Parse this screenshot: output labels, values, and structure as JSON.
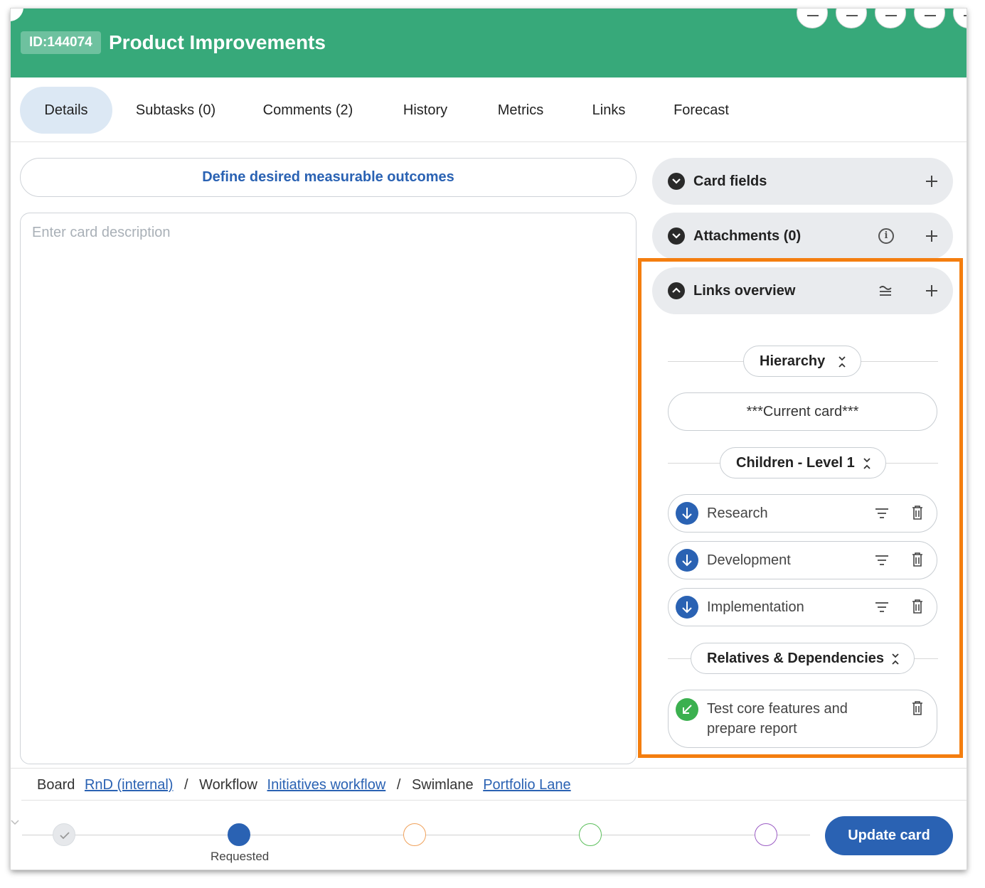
{
  "header": {
    "id_badge": "ID:144074",
    "title": "Product Improvements",
    "background_color": "#37a97a"
  },
  "tabs": [
    {
      "label": "Details",
      "active": true
    },
    {
      "label": "Subtasks (0)"
    },
    {
      "label": "Comments (2)"
    },
    {
      "label": "History"
    },
    {
      "label": "Metrics"
    },
    {
      "label": "Links"
    },
    {
      "label": "Forecast"
    }
  ],
  "main": {
    "outcomes_button": "Define desired measurable outcomes",
    "description_placeholder": "Enter card description"
  },
  "panels": {
    "card_fields": {
      "title": "Card fields",
      "icon": "chevron-down-icon"
    },
    "attachments": {
      "title": "Attachments (0)",
      "icon": "chevron-down-icon"
    },
    "links_overview": {
      "title": "Links overview",
      "icon": "chevron-up-icon"
    }
  },
  "links_overview": {
    "hierarchy_label": "Hierarchy",
    "current_card": "***Current card***",
    "children_label": "Children - Level 1",
    "children": [
      {
        "label": "Research",
        "icon": "arrow-down-icon"
      },
      {
        "label": "Development",
        "icon": "arrow-down-icon"
      },
      {
        "label": "Implementation",
        "icon": "arrow-down-icon"
      }
    ],
    "relatives_label": "Relatives & Dependencies",
    "relatives": [
      {
        "line1": "Test core features and",
        "line2": "prepare report",
        "icon": "arrow-down-left-icon"
      }
    ],
    "highlight_color": "#f47e0f"
  },
  "breadcrumb": {
    "board_label": "Board",
    "board_value": "RnD (internal)",
    "workflow_label": "Workflow",
    "workflow_value": "Initiatives workflow",
    "swimlane_label": "Swimlane",
    "swimlane_value": "Portfolio Lane",
    "separator": "/"
  },
  "workflow_steps": [
    {
      "state": "done",
      "color": "#d9dde1",
      "label": ""
    },
    {
      "state": "current",
      "color": "#2a62b3",
      "label": "Requested"
    },
    {
      "state": "future",
      "color": "#f0a15a",
      "label": ""
    },
    {
      "state": "future",
      "color": "#5cbf5c",
      "label": ""
    },
    {
      "state": "future",
      "color": "#9b5cc4",
      "label": ""
    }
  ],
  "actions": {
    "update_button": "Update card",
    "accent_color": "#2a62b3"
  }
}
